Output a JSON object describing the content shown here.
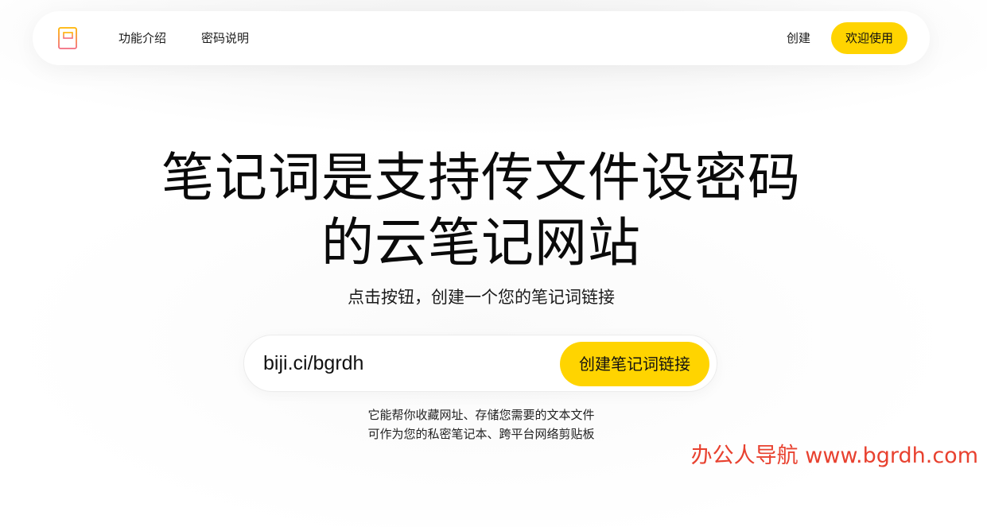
{
  "nav": {
    "features": "功能介绍",
    "password": "密码说明",
    "create": "创建",
    "welcome": "欢迎使用"
  },
  "hero": {
    "title_line1": "笔记词是支持传文件设密码",
    "title_line2": "的云笔记网站",
    "subtitle": "点击按钮，创建一个您的笔记词链接"
  },
  "form": {
    "input_value": "biji.ci/bgrdh",
    "button_label": "创建笔记词链接"
  },
  "description": {
    "line1": "它能帮你收藏网址、存储您需要的文本文件",
    "line2": "可作为您的私密笔记本、跨平台网络剪贴板"
  },
  "watermark": "办公人导航 www.bgrdh.com",
  "icons": {
    "logo": "notebook-logo-icon"
  },
  "colors": {
    "accent": "#ffd400",
    "watermark": "#e8412f",
    "logo_gradient_start": "#ffb400",
    "logo_gradient_end": "#f36b7f"
  }
}
